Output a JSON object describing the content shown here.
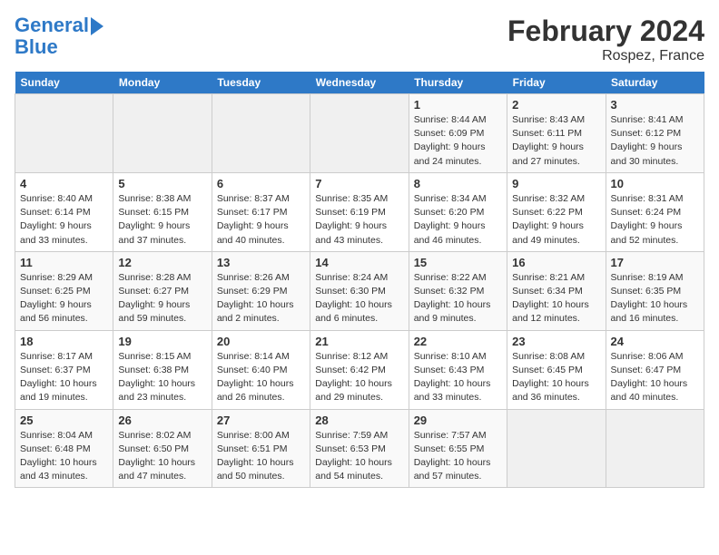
{
  "logo": {
    "line1": "General",
    "line2": "Blue"
  },
  "title": "February 2024",
  "subtitle": "Rospez, France",
  "days_of_week": [
    "Sunday",
    "Monday",
    "Tuesday",
    "Wednesday",
    "Thursday",
    "Friday",
    "Saturday"
  ],
  "weeks": [
    [
      {
        "day": "",
        "info": ""
      },
      {
        "day": "",
        "info": ""
      },
      {
        "day": "",
        "info": ""
      },
      {
        "day": "",
        "info": ""
      },
      {
        "day": "1",
        "info": "Sunrise: 8:44 AM\nSunset: 6:09 PM\nDaylight: 9 hours and 24 minutes."
      },
      {
        "day": "2",
        "info": "Sunrise: 8:43 AM\nSunset: 6:11 PM\nDaylight: 9 hours and 27 minutes."
      },
      {
        "day": "3",
        "info": "Sunrise: 8:41 AM\nSunset: 6:12 PM\nDaylight: 9 hours and 30 minutes."
      }
    ],
    [
      {
        "day": "4",
        "info": "Sunrise: 8:40 AM\nSunset: 6:14 PM\nDaylight: 9 hours and 33 minutes."
      },
      {
        "day": "5",
        "info": "Sunrise: 8:38 AM\nSunset: 6:15 PM\nDaylight: 9 hours and 37 minutes."
      },
      {
        "day": "6",
        "info": "Sunrise: 8:37 AM\nSunset: 6:17 PM\nDaylight: 9 hours and 40 minutes."
      },
      {
        "day": "7",
        "info": "Sunrise: 8:35 AM\nSunset: 6:19 PM\nDaylight: 9 hours and 43 minutes."
      },
      {
        "day": "8",
        "info": "Sunrise: 8:34 AM\nSunset: 6:20 PM\nDaylight: 9 hours and 46 minutes."
      },
      {
        "day": "9",
        "info": "Sunrise: 8:32 AM\nSunset: 6:22 PM\nDaylight: 9 hours and 49 minutes."
      },
      {
        "day": "10",
        "info": "Sunrise: 8:31 AM\nSunset: 6:24 PM\nDaylight: 9 hours and 52 minutes."
      }
    ],
    [
      {
        "day": "11",
        "info": "Sunrise: 8:29 AM\nSunset: 6:25 PM\nDaylight: 9 hours and 56 minutes."
      },
      {
        "day": "12",
        "info": "Sunrise: 8:28 AM\nSunset: 6:27 PM\nDaylight: 9 hours and 59 minutes."
      },
      {
        "day": "13",
        "info": "Sunrise: 8:26 AM\nSunset: 6:29 PM\nDaylight: 10 hours and 2 minutes."
      },
      {
        "day": "14",
        "info": "Sunrise: 8:24 AM\nSunset: 6:30 PM\nDaylight: 10 hours and 6 minutes."
      },
      {
        "day": "15",
        "info": "Sunrise: 8:22 AM\nSunset: 6:32 PM\nDaylight: 10 hours and 9 minutes."
      },
      {
        "day": "16",
        "info": "Sunrise: 8:21 AM\nSunset: 6:34 PM\nDaylight: 10 hours and 12 minutes."
      },
      {
        "day": "17",
        "info": "Sunrise: 8:19 AM\nSunset: 6:35 PM\nDaylight: 10 hours and 16 minutes."
      }
    ],
    [
      {
        "day": "18",
        "info": "Sunrise: 8:17 AM\nSunset: 6:37 PM\nDaylight: 10 hours and 19 minutes."
      },
      {
        "day": "19",
        "info": "Sunrise: 8:15 AM\nSunset: 6:38 PM\nDaylight: 10 hours and 23 minutes."
      },
      {
        "day": "20",
        "info": "Sunrise: 8:14 AM\nSunset: 6:40 PM\nDaylight: 10 hours and 26 minutes."
      },
      {
        "day": "21",
        "info": "Sunrise: 8:12 AM\nSunset: 6:42 PM\nDaylight: 10 hours and 29 minutes."
      },
      {
        "day": "22",
        "info": "Sunrise: 8:10 AM\nSunset: 6:43 PM\nDaylight: 10 hours and 33 minutes."
      },
      {
        "day": "23",
        "info": "Sunrise: 8:08 AM\nSunset: 6:45 PM\nDaylight: 10 hours and 36 minutes."
      },
      {
        "day": "24",
        "info": "Sunrise: 8:06 AM\nSunset: 6:47 PM\nDaylight: 10 hours and 40 minutes."
      }
    ],
    [
      {
        "day": "25",
        "info": "Sunrise: 8:04 AM\nSunset: 6:48 PM\nDaylight: 10 hours and 43 minutes."
      },
      {
        "day": "26",
        "info": "Sunrise: 8:02 AM\nSunset: 6:50 PM\nDaylight: 10 hours and 47 minutes."
      },
      {
        "day": "27",
        "info": "Sunrise: 8:00 AM\nSunset: 6:51 PM\nDaylight: 10 hours and 50 minutes."
      },
      {
        "day": "28",
        "info": "Sunrise: 7:59 AM\nSunset: 6:53 PM\nDaylight: 10 hours and 54 minutes."
      },
      {
        "day": "29",
        "info": "Sunrise: 7:57 AM\nSunset: 6:55 PM\nDaylight: 10 hours and 57 minutes."
      },
      {
        "day": "",
        "info": ""
      },
      {
        "day": "",
        "info": ""
      }
    ]
  ]
}
